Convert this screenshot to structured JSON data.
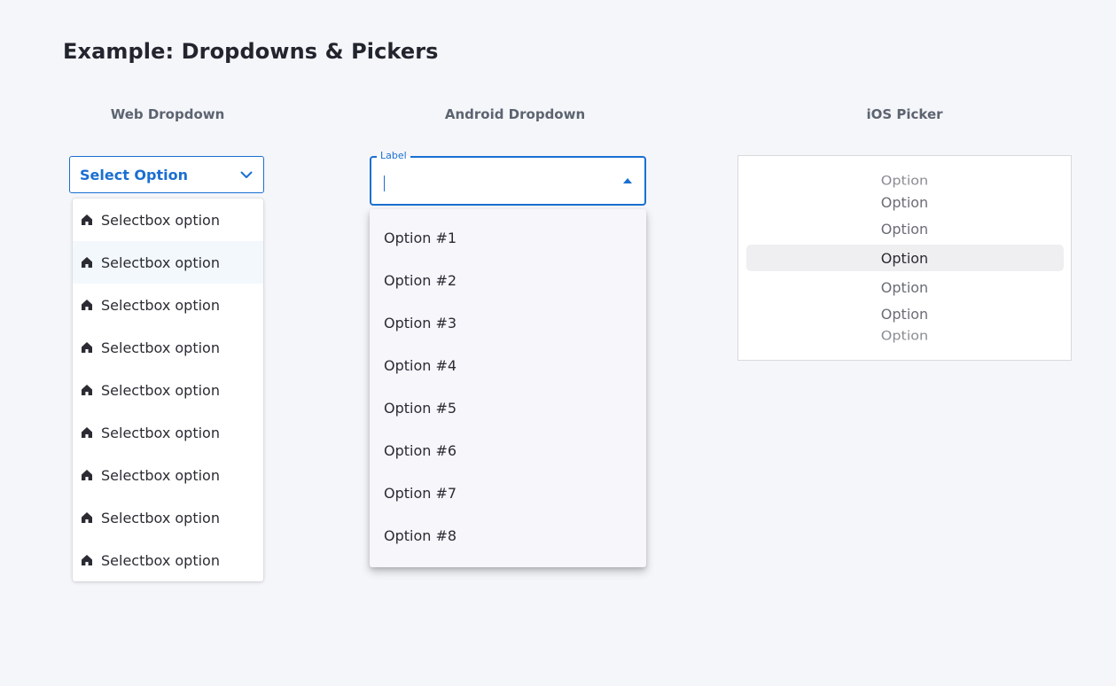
{
  "page": {
    "title": "Example: Dropdowns & Pickers"
  },
  "web_dropdown": {
    "heading": "Web Dropdown",
    "selected_text": "Select Option",
    "chevron_icon": "chevron-down-icon",
    "option_icon": "home-icon",
    "options": [
      "Selectbox option",
      "Selectbox option",
      "Selectbox option",
      "Selectbox option",
      "Selectbox option",
      "Selectbox option",
      "Selectbox option",
      "Selectbox option",
      "Selectbox option"
    ],
    "hovered_index": 1,
    "accent_color": "#1a6fd1"
  },
  "android_dropdown": {
    "heading": "Android Dropdown",
    "label": "Label",
    "value": "",
    "arrow_icon": "arrow-up-icon",
    "options": [
      "Option #1",
      "Option #2",
      "Option #3",
      "Option #4",
      "Option #5",
      "Option #6",
      "Option #7",
      "Option #8"
    ],
    "accent_color": "#1a6fd1"
  },
  "ios_picker": {
    "heading": "iOS Picker",
    "options": [
      "Option",
      "Option",
      "Option",
      "Option",
      "Option",
      "Option",
      "Option"
    ],
    "selected_index": 3
  }
}
